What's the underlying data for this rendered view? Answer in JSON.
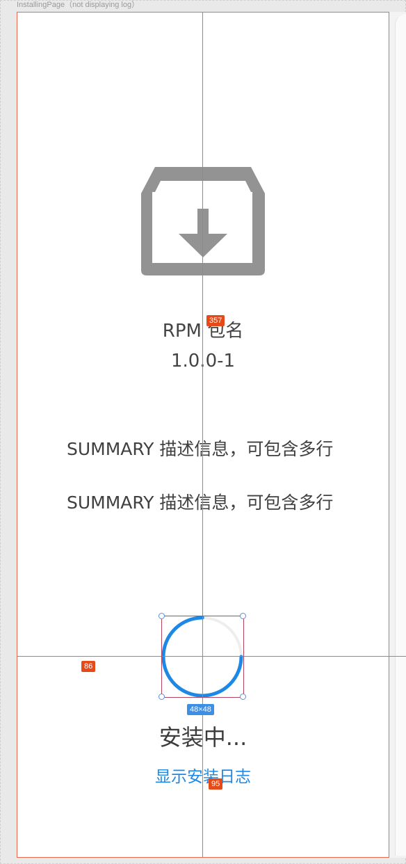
{
  "frame": {
    "label": "InstallingPage（not displaying log）"
  },
  "icons": {
    "package": "package-download-icon",
    "spinner": "loading-spinner-icon"
  },
  "package": {
    "name": "RPM 包名",
    "version": "1.0.0-1"
  },
  "summary": {
    "lines": [
      "SUMMARY 描述信息，可包含多行",
      "SUMMARY 描述信息，可包含多行"
    ]
  },
  "status": {
    "text": "安装中...",
    "progress": 0.75
  },
  "actions": {
    "show_log": "显示安装日志"
  },
  "measurements": {
    "vertical": "357",
    "left_gap": "86",
    "spinner_size": "48×48",
    "bottom_gap": "95"
  },
  "colors": {
    "accent": "#1e88e5",
    "icon_gray": "#939393",
    "guide": "#e8694d"
  }
}
